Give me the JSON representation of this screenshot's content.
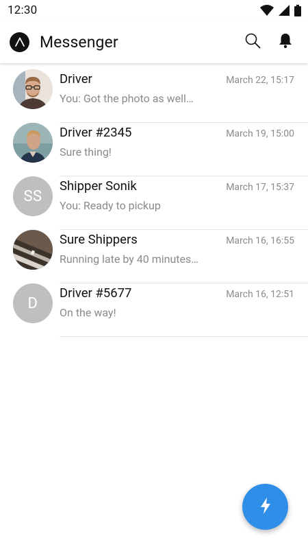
{
  "status_bar": {
    "time": "12:30"
  },
  "app_bar": {
    "title": "Messenger"
  },
  "conversations": [
    {
      "name": "Driver",
      "time": "March 22, 15:17",
      "preview": "You: Got the photo as well…",
      "avatar_type": "photo",
      "avatar_initials": ""
    },
    {
      "name": "Driver #2345",
      "time": "March  19, 15:00",
      "preview": "Sure thing!",
      "avatar_type": "photo",
      "avatar_initials": ""
    },
    {
      "name": "Shipper Sonik",
      "time": "March 17, 15:37",
      "preview": "You:  Ready to pickup",
      "avatar_type": "initials",
      "avatar_initials": "SS"
    },
    {
      "name": "Sure Shippers",
      "time": "March 16, 16:55",
      "preview": "Running late by 40 minutes…",
      "avatar_type": "photo",
      "avatar_initials": ""
    },
    {
      "name": "Driver #5677",
      "time": "March 16, 12:51",
      "preview": "On the way!",
      "avatar_type": "initials",
      "avatar_initials": "D"
    }
  ],
  "colors": {
    "fab": "#2f8fe8",
    "initials_avatar_bg": "#bfbfbf",
    "secondary_text": "#8a8a8a",
    "divider": "#e2e2e2"
  },
  "icons": {
    "logo": "app-logo-icon",
    "search": "search-icon",
    "notifications": "bell-icon",
    "fab": "lightning-bolt-icon"
  }
}
